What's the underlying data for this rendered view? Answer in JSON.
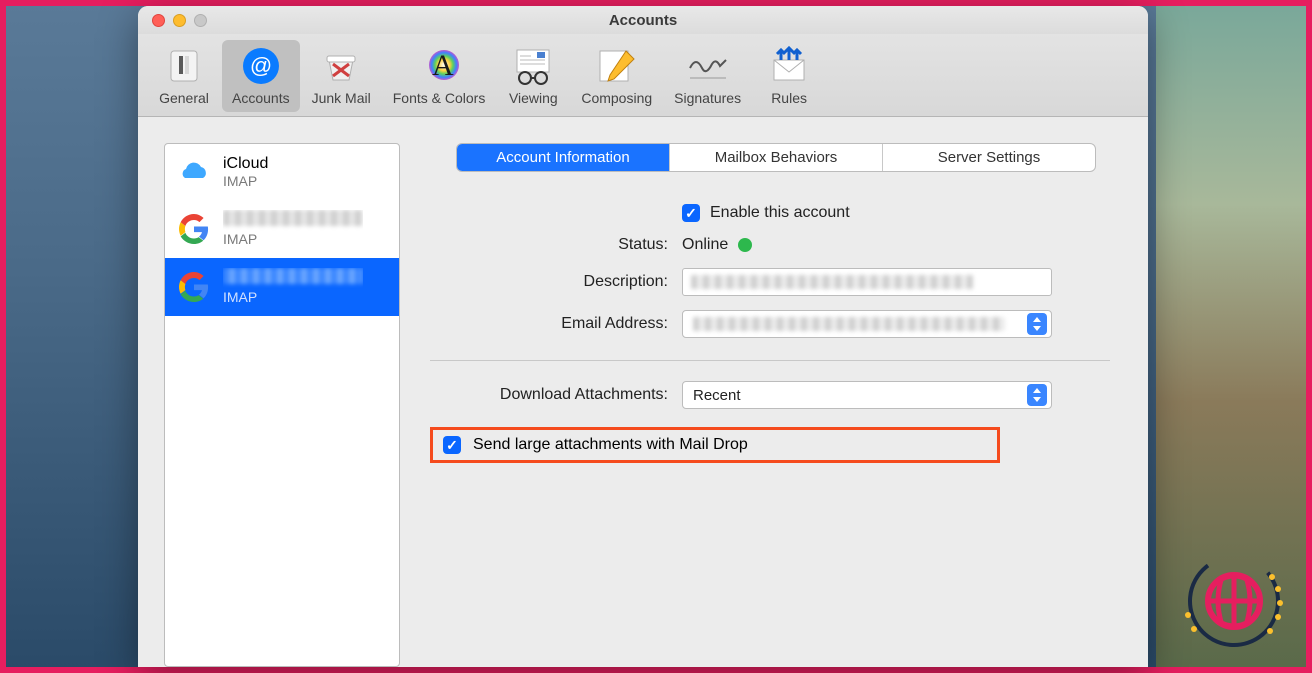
{
  "window_title": "Accounts",
  "toolbar": [
    {
      "label": "General"
    },
    {
      "label": "Accounts"
    },
    {
      "label": "Junk Mail"
    },
    {
      "label": "Fonts & Colors"
    },
    {
      "label": "Viewing"
    },
    {
      "label": "Composing"
    },
    {
      "label": "Signatures"
    },
    {
      "label": "Rules"
    }
  ],
  "sidebar": [
    {
      "name": "iCloud",
      "sub": "IMAP",
      "provider": "icloud"
    },
    {
      "name": "",
      "sub": "IMAP",
      "provider": "google",
      "blurred": true
    },
    {
      "name": "",
      "sub": "IMAP",
      "provider": "google",
      "blurred": true,
      "selected": true
    }
  ],
  "tabs": {
    "t0": "Account Information",
    "t1": "Mailbox Behaviors",
    "t2": "Server Settings"
  },
  "form": {
    "enable_label": "Enable this account",
    "status_label": "Status:",
    "status_value": "Online",
    "description_label": "Description:",
    "email_label": "Email Address:",
    "download_label": "Download Attachments:",
    "download_value": "Recent",
    "maildrop_label": "Send large attachments with Mail Drop"
  },
  "colors": {
    "accent": "#0a66ff",
    "highlight": "#f54b1d",
    "status_online": "#2db84d"
  }
}
